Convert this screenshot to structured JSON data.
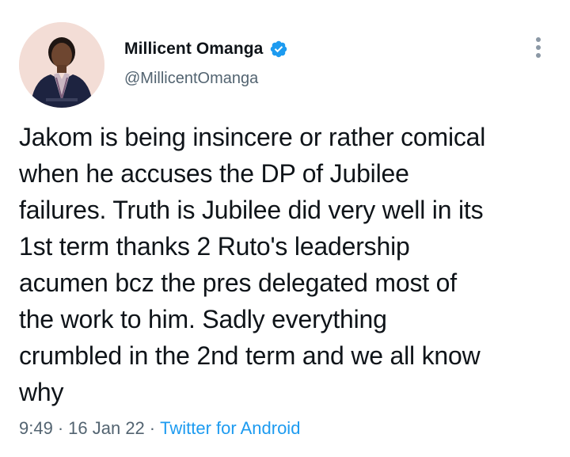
{
  "author": {
    "display_name": "Millicent Omanga",
    "handle": "@MillicentOmanga",
    "verified_icon": "verified-badge-icon",
    "avatar": "profile-photo"
  },
  "tweet": {
    "text": "Jakom is being insincere or rather comical\nwhen he accuses the DP of Jubilee\nfailures. Truth is Jubilee did very well in its\n1st term thanks 2 Ruto's leadership\nacumen bcz the pres delegated most of\nthe work to him. Sadly everything\ncrumbled in the 2nd term and we all know\nwhy",
    "time": "9:49",
    "separator": "·",
    "date": "16 Jan 22",
    "source": "Twitter for Android"
  },
  "colors": {
    "text": "#0f1419",
    "secondary": "#536471",
    "accent": "#1d9bf0"
  },
  "menu_icon": "more-options-icon"
}
